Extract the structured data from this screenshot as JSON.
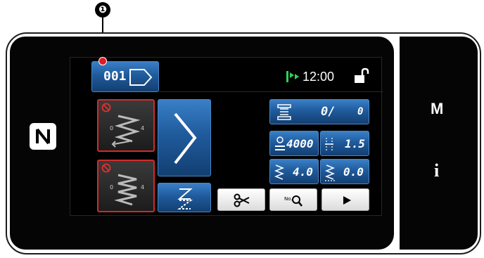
{
  "callout": {
    "number": "❶"
  },
  "header": {
    "pattern_number": "001",
    "time": "12:00",
    "lock_icon": "unlock-icon",
    "signal_icon": "green-flag-icon"
  },
  "device": {
    "nfc_icon": "nfc-mark-icon",
    "right_panel": {
      "mode_button_label": "M",
      "info_button_label": "i"
    }
  },
  "stitch_panel": {
    "top_pattern_disabled": true,
    "bottom_pattern_disabled": true,
    "sub_pattern_label": "N"
  },
  "counter": {
    "value": "0/",
    "total": "0"
  },
  "parameters": {
    "speed": "4000",
    "pitch": "1.5",
    "width": "4.0",
    "offset": "0.0"
  },
  "toolbar": {
    "thread_trim_icon": "scissors-icon",
    "search_icon": "search-icon",
    "play_icon": "play-icon"
  },
  "colors": {
    "accent_blue": "#1f5b9c",
    "disabled_red": "#d12b2b",
    "signal_green": "#2bd45a"
  }
}
